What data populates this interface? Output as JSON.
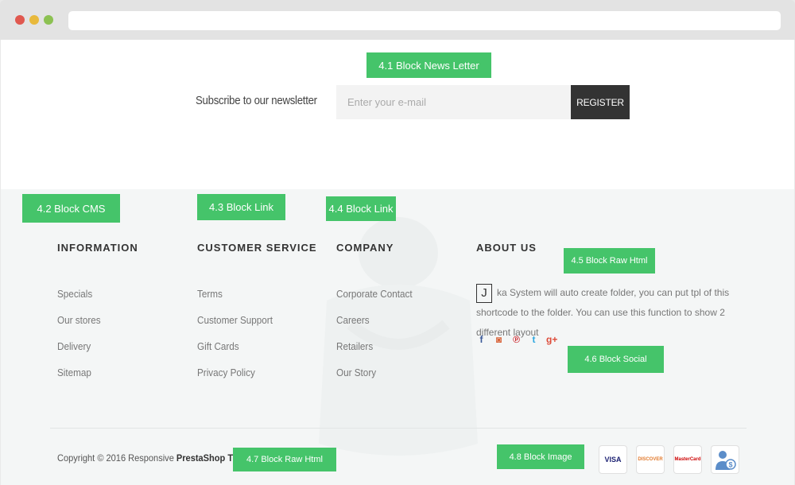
{
  "newsletter": {
    "label": "4.1 Block News Letter",
    "heading": "Subscribe to our newsletter",
    "email_placeholder": "Enter your e-mail",
    "register_label": "REGISTER"
  },
  "labels": {
    "cms": "4.2  Block CMS",
    "link1": "4.3  Block Link",
    "link2": "4.4 Block Link",
    "raw_html1": "4.5  Block Raw Html",
    "social": "4.6  Block Social",
    "raw_html2": "4.7  Block Raw Html",
    "image": "4.8  Block Image"
  },
  "columns": {
    "information": {
      "title": "INFORMATION",
      "items": [
        "Specials",
        "Our stores",
        "Delivery",
        "Sitemap"
      ]
    },
    "customer_service": {
      "title": "CUSTOMER SERVICE",
      "items": [
        "Terms",
        "Customer Support",
        "Gift Cards",
        "Privacy Policy"
      ]
    },
    "company": {
      "title": "COMPANY",
      "items": [
        "Corporate Contact",
        "Careers",
        "Retailers",
        "Our Story"
      ]
    },
    "about": {
      "title": "ABOUT US",
      "j_letter": "J",
      "text": "ka System will auto create folder, you can put tpl of this shortcode to the folder. You can use this function to show 2 different layout"
    }
  },
  "social_icons": [
    "facebook-icon",
    "instagram-icon",
    "pinterest-icon",
    "twitter-icon",
    "google-plus-icon"
  ],
  "copyright": {
    "prefix": "Copyright © 2016 Responsive ",
    "brand": "PrestaShop Theme"
  },
  "payment_cards": {
    "visa": "VISA",
    "discover": "DISCOVER",
    "mastercard": "MasterCard"
  },
  "colors": {
    "accent_green": "#45c46a",
    "register_bg": "#333333",
    "footer_bg": "#f4f6f6"
  }
}
